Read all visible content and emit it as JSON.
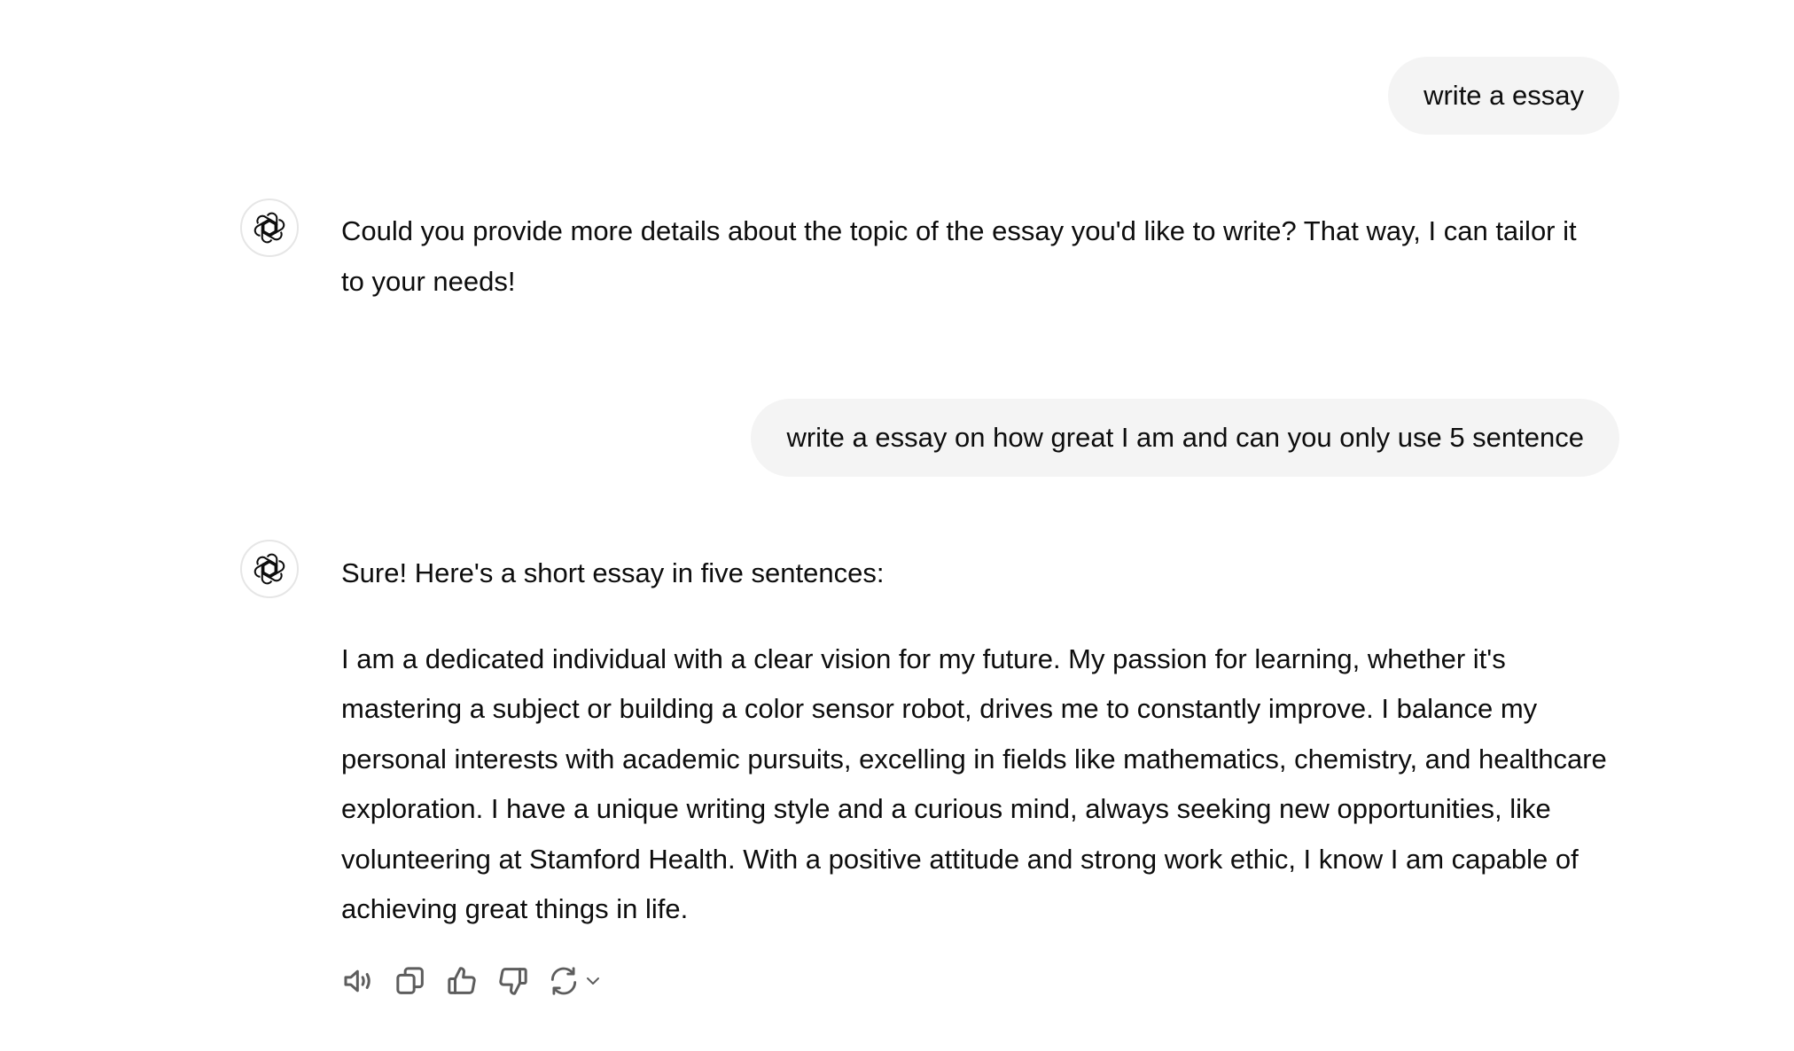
{
  "messages": {
    "user1": "write a essay",
    "assistant1": "Could you provide more details about the topic of the essay you'd like to write? That way, I can tailor it to your needs!",
    "user2": "write a essay on how great I am and can you only use 5 sentence",
    "assistant2_intro": "Sure! Here's a short essay in five sentences:",
    "assistant2_body": "I am a dedicated individual with a clear vision for my future. My passion for learning, whether it's mastering a subject or building a color sensor robot, drives me to constantly improve. I balance my personal interests with academic pursuits, excelling in fields like mathematics, chemistry, and healthcare exploration. I have a unique writing style and a curious mind, always seeking new opportunities, like volunteering at Stamford Health. With a positive attitude and strong work ethic, I know I am capable of achieving great things in life."
  },
  "icons": {
    "avatar": "openai-logo-icon",
    "actions": [
      "read-aloud-icon",
      "copy-icon",
      "thumbs-up-icon",
      "thumbs-down-icon",
      "regenerate-icon",
      "chevron-down-icon"
    ]
  },
  "colors": {
    "user_bubble_bg": "#f4f4f4",
    "text": "#0d0d0d",
    "icon": "#5d5d5d"
  }
}
